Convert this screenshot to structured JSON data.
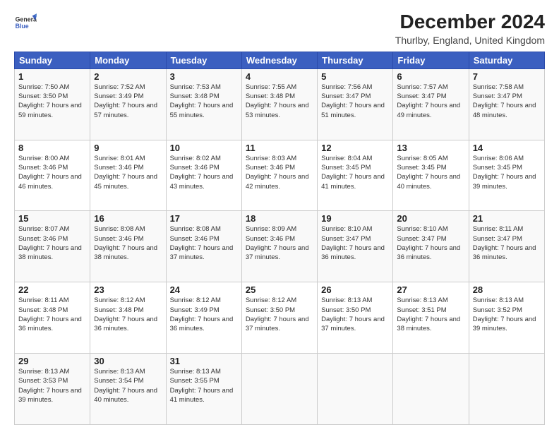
{
  "header": {
    "logo_line1": "General",
    "logo_line2": "Blue",
    "title": "December 2024",
    "subtitle": "Thurlby, England, United Kingdom"
  },
  "columns": [
    "Sunday",
    "Monday",
    "Tuesday",
    "Wednesday",
    "Thursday",
    "Friday",
    "Saturday"
  ],
  "weeks": [
    [
      {
        "day": "1",
        "sunrise": "Sunrise: 7:50 AM",
        "sunset": "Sunset: 3:50 PM",
        "daylight": "Daylight: 7 hours and 59 minutes."
      },
      {
        "day": "2",
        "sunrise": "Sunrise: 7:52 AM",
        "sunset": "Sunset: 3:49 PM",
        "daylight": "Daylight: 7 hours and 57 minutes."
      },
      {
        "day": "3",
        "sunrise": "Sunrise: 7:53 AM",
        "sunset": "Sunset: 3:48 PM",
        "daylight": "Daylight: 7 hours and 55 minutes."
      },
      {
        "day": "4",
        "sunrise": "Sunrise: 7:55 AM",
        "sunset": "Sunset: 3:48 PM",
        "daylight": "Daylight: 7 hours and 53 minutes."
      },
      {
        "day": "5",
        "sunrise": "Sunrise: 7:56 AM",
        "sunset": "Sunset: 3:47 PM",
        "daylight": "Daylight: 7 hours and 51 minutes."
      },
      {
        "day": "6",
        "sunrise": "Sunrise: 7:57 AM",
        "sunset": "Sunset: 3:47 PM",
        "daylight": "Daylight: 7 hours and 49 minutes."
      },
      {
        "day": "7",
        "sunrise": "Sunrise: 7:58 AM",
        "sunset": "Sunset: 3:47 PM",
        "daylight": "Daylight: 7 hours and 48 minutes."
      }
    ],
    [
      {
        "day": "8",
        "sunrise": "Sunrise: 8:00 AM",
        "sunset": "Sunset: 3:46 PM",
        "daylight": "Daylight: 7 hours and 46 minutes."
      },
      {
        "day": "9",
        "sunrise": "Sunrise: 8:01 AM",
        "sunset": "Sunset: 3:46 PM",
        "daylight": "Daylight: 7 hours and 45 minutes."
      },
      {
        "day": "10",
        "sunrise": "Sunrise: 8:02 AM",
        "sunset": "Sunset: 3:46 PM",
        "daylight": "Daylight: 7 hours and 43 minutes."
      },
      {
        "day": "11",
        "sunrise": "Sunrise: 8:03 AM",
        "sunset": "Sunset: 3:46 PM",
        "daylight": "Daylight: 7 hours and 42 minutes."
      },
      {
        "day": "12",
        "sunrise": "Sunrise: 8:04 AM",
        "sunset": "Sunset: 3:45 PM",
        "daylight": "Daylight: 7 hours and 41 minutes."
      },
      {
        "day": "13",
        "sunrise": "Sunrise: 8:05 AM",
        "sunset": "Sunset: 3:45 PM",
        "daylight": "Daylight: 7 hours and 40 minutes."
      },
      {
        "day": "14",
        "sunrise": "Sunrise: 8:06 AM",
        "sunset": "Sunset: 3:45 PM",
        "daylight": "Daylight: 7 hours and 39 minutes."
      }
    ],
    [
      {
        "day": "15",
        "sunrise": "Sunrise: 8:07 AM",
        "sunset": "Sunset: 3:46 PM",
        "daylight": "Daylight: 7 hours and 38 minutes."
      },
      {
        "day": "16",
        "sunrise": "Sunrise: 8:08 AM",
        "sunset": "Sunset: 3:46 PM",
        "daylight": "Daylight: 7 hours and 38 minutes."
      },
      {
        "day": "17",
        "sunrise": "Sunrise: 8:08 AM",
        "sunset": "Sunset: 3:46 PM",
        "daylight": "Daylight: 7 hours and 37 minutes."
      },
      {
        "day": "18",
        "sunrise": "Sunrise: 8:09 AM",
        "sunset": "Sunset: 3:46 PM",
        "daylight": "Daylight: 7 hours and 37 minutes."
      },
      {
        "day": "19",
        "sunrise": "Sunrise: 8:10 AM",
        "sunset": "Sunset: 3:47 PM",
        "daylight": "Daylight: 7 hours and 36 minutes."
      },
      {
        "day": "20",
        "sunrise": "Sunrise: 8:10 AM",
        "sunset": "Sunset: 3:47 PM",
        "daylight": "Daylight: 7 hours and 36 minutes."
      },
      {
        "day": "21",
        "sunrise": "Sunrise: 8:11 AM",
        "sunset": "Sunset: 3:47 PM",
        "daylight": "Daylight: 7 hours and 36 minutes."
      }
    ],
    [
      {
        "day": "22",
        "sunrise": "Sunrise: 8:11 AM",
        "sunset": "Sunset: 3:48 PM",
        "daylight": "Daylight: 7 hours and 36 minutes."
      },
      {
        "day": "23",
        "sunrise": "Sunrise: 8:12 AM",
        "sunset": "Sunset: 3:48 PM",
        "daylight": "Daylight: 7 hours and 36 minutes."
      },
      {
        "day": "24",
        "sunrise": "Sunrise: 8:12 AM",
        "sunset": "Sunset: 3:49 PM",
        "daylight": "Daylight: 7 hours and 36 minutes."
      },
      {
        "day": "25",
        "sunrise": "Sunrise: 8:12 AM",
        "sunset": "Sunset: 3:50 PM",
        "daylight": "Daylight: 7 hours and 37 minutes."
      },
      {
        "day": "26",
        "sunrise": "Sunrise: 8:13 AM",
        "sunset": "Sunset: 3:50 PM",
        "daylight": "Daylight: 7 hours and 37 minutes."
      },
      {
        "day": "27",
        "sunrise": "Sunrise: 8:13 AM",
        "sunset": "Sunset: 3:51 PM",
        "daylight": "Daylight: 7 hours and 38 minutes."
      },
      {
        "day": "28",
        "sunrise": "Sunrise: 8:13 AM",
        "sunset": "Sunset: 3:52 PM",
        "daylight": "Daylight: 7 hours and 39 minutes."
      }
    ],
    [
      {
        "day": "29",
        "sunrise": "Sunrise: 8:13 AM",
        "sunset": "Sunset: 3:53 PM",
        "daylight": "Daylight: 7 hours and 39 minutes."
      },
      {
        "day": "30",
        "sunrise": "Sunrise: 8:13 AM",
        "sunset": "Sunset: 3:54 PM",
        "daylight": "Daylight: 7 hours and 40 minutes."
      },
      {
        "day": "31",
        "sunrise": "Sunrise: 8:13 AM",
        "sunset": "Sunset: 3:55 PM",
        "daylight": "Daylight: 7 hours and 41 minutes."
      },
      null,
      null,
      null,
      null
    ]
  ]
}
